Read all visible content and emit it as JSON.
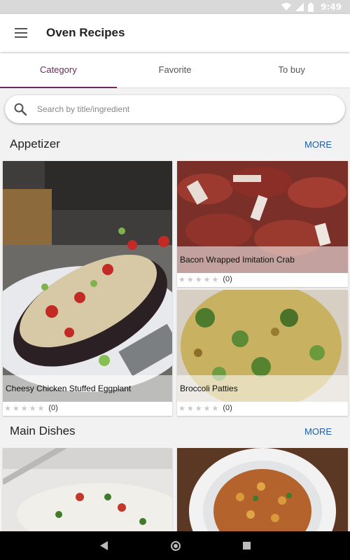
{
  "status_bar": {
    "time": "9:49"
  },
  "app_bar": {
    "title": "Oven Recipes",
    "menu_icon": "hamburger-menu-icon"
  },
  "tabs": [
    {
      "label": "Category",
      "active": true
    },
    {
      "label": "Favorite",
      "active": false
    },
    {
      "label": "To buy",
      "active": false
    }
  ],
  "search": {
    "placeholder": "Search by title/ingredient",
    "value": ""
  },
  "sections": [
    {
      "title": "Appetizer",
      "more_label": "MORE",
      "recipes": [
        {
          "title": "Cheesy Chicken Stuffed Eggplant",
          "rating_count": "(0)"
        },
        {
          "title": "Bacon Wrapped Imitation Crab",
          "rating_count": "(0)"
        },
        {
          "title": "Broccoli Patties",
          "rating_count": "(0)"
        }
      ]
    },
    {
      "title": "Main Dishes",
      "more_label": "MORE"
    }
  ],
  "colors": {
    "accent": "#6d2a5d",
    "more_link": "#1f5fa8"
  }
}
